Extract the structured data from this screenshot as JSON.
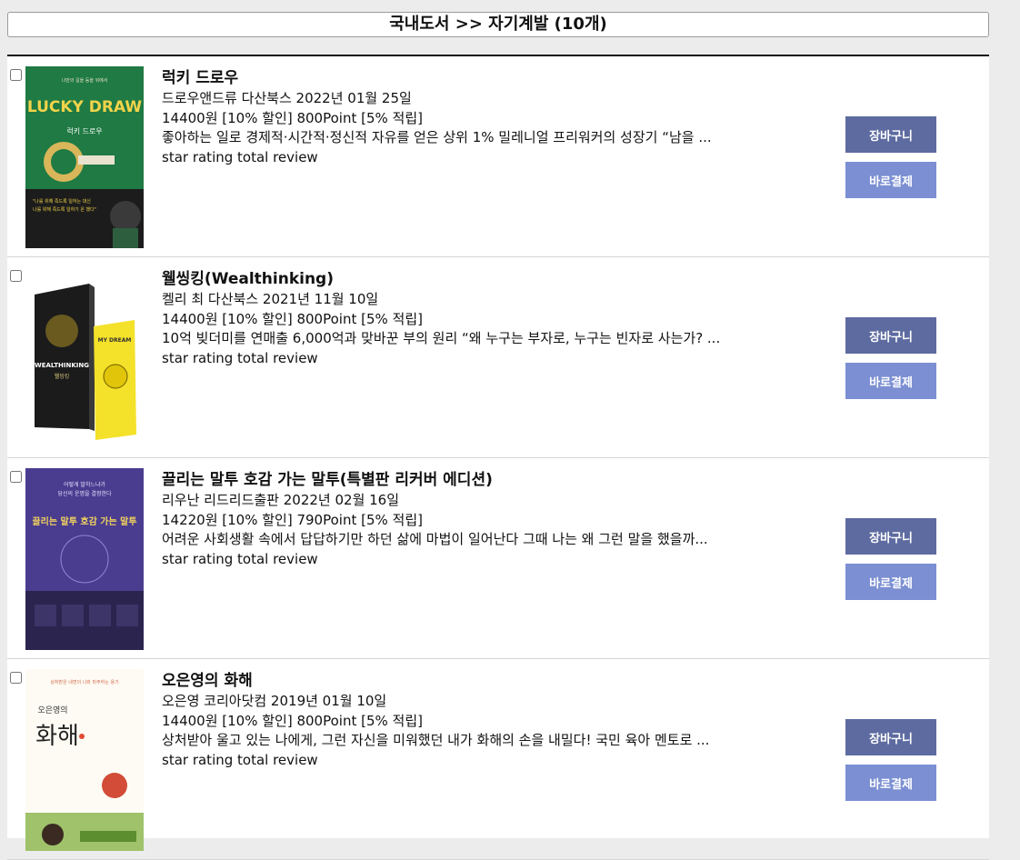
{
  "header": {
    "title": "국내도서 >> 자기계발 (10개)"
  },
  "buttons": {
    "cart": "장바구니",
    "buy": "바로결제"
  },
  "books": [
    {
      "title": "럭키 드로우",
      "meta": "드로우앤드류 다산북스 2022년 01월 25일",
      "price": "14400원 [10% 할인] 800Point [5% 적립]",
      "desc": "좋아하는 일로 경제적·시간적·정신적 자유를 얻은 상위 1% 밀레니얼 프리워커의 성장기 “남을 ...",
      "rating": "star rating total review",
      "cover_text": "LUCKY DRAW"
    },
    {
      "title": "웰씽킹(Wealthinking)",
      "meta": "켈리 최 다산북스 2021년 11월 10일",
      "price": "14400원 [10% 할인] 800Point [5% 적립]",
      "desc": "10억 빚더미를 연매출 6,000억과 맞바꾼 부의 원리 “왜 누구는 부자로, 누구는 빈자로 사는가? ...",
      "rating": "star rating total review",
      "cover_text": "WEALTHINKING"
    },
    {
      "title": "끌리는 말투 호감 가는 말투(특별판 리커버 에디션)",
      "meta": "리우난 리드리드출판 2022년 02월 16일",
      "price": "14220원 [10% 할인] 790Point [5% 적립]",
      "desc": "어려운 사회생활 속에서 답답하기만 하던 삶에 마법이 일어난다 그때 나는 왜 그런 말을 했을까...",
      "rating": "star rating total review",
      "cover_text": "끌리는 말투 호감 가는 말투"
    },
    {
      "title": "오은영의 화해",
      "meta": "오은영 코리아닷컴 2019년 01월 10일",
      "price": "14400원 [10% 할인] 800Point [5% 적립]",
      "desc": "상처받아 울고 있는 나에게, 그런 자신을 미워했던 내가 화해의 손을 내밀다! 국민 육아 멘토로 ...",
      "rating": "star rating total review",
      "cover_text": "화해"
    }
  ]
}
